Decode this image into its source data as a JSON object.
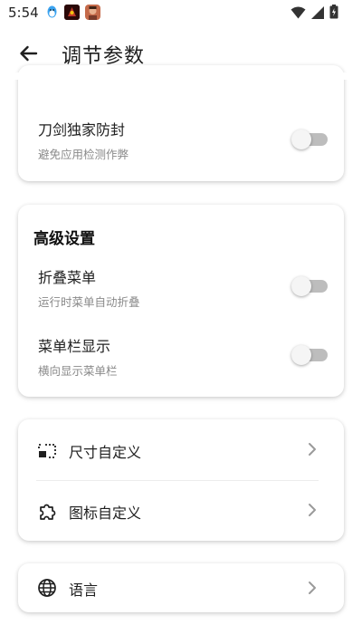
{
  "status_bar": {
    "time": "5:54",
    "icons": [
      "qq-icon",
      "app-thumbnail-icon",
      "avatar-icon",
      "wifi-icon",
      "signal-icon",
      "battery-icon"
    ]
  },
  "app_bar": {
    "title": "调节参数",
    "back_icon": "arrow-back-icon"
  },
  "card_top": {
    "row": {
      "title": "刀剑独家防封",
      "subtitle": "避免应用检测作弊",
      "enabled": false
    }
  },
  "card_advanced": {
    "title": "高级设置",
    "rows": [
      {
        "title": "折叠菜单",
        "subtitle": "运行时菜单自动折叠",
        "enabled": false
      },
      {
        "title": "菜单栏显示",
        "subtitle": "横向显示菜单栏",
        "enabled": false
      }
    ]
  },
  "card_custom": {
    "items": [
      {
        "label": "尺寸自定义",
        "icon": "resize-icon"
      },
      {
        "label": "图标自定义",
        "icon": "puzzle-icon"
      }
    ]
  },
  "card_language": {
    "label": "语言",
    "icon": "globe-icon"
  },
  "colors": {
    "switch_off_track": "#bdbdbd",
    "switch_off_thumb": "#f5f5f5",
    "subtitle": "#8a8a8a"
  }
}
